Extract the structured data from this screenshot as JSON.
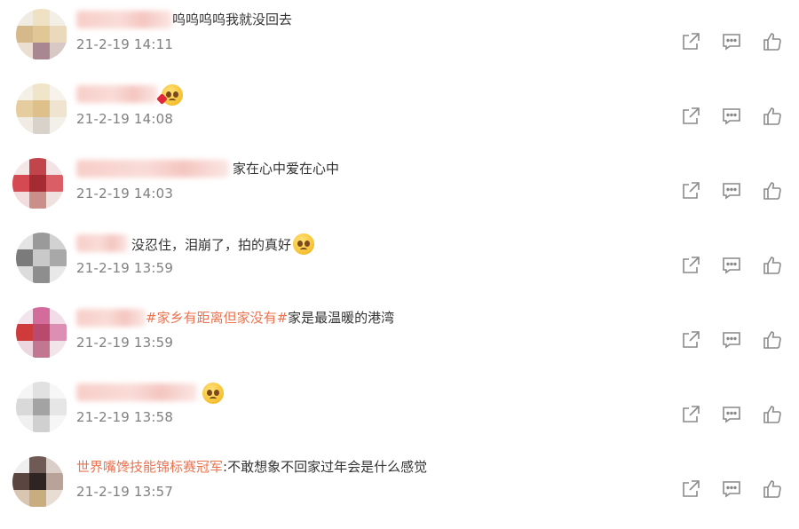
{
  "comments": [
    {
      "text": "呜呜呜呜我就没回去",
      "text_hl": "",
      "emoji": "",
      "time": "21-2-19 14:11"
    },
    {
      "text": "",
      "text_hl": "",
      "emoji": "kiss-face-emoji",
      "time": "21-2-19 14:08"
    },
    {
      "text": "家在心中爱在心中",
      "text_hl": "",
      "emoji": "",
      "time": "21-2-19 14:03"
    },
    {
      "text": "没忍住，泪崩了，拍的真好",
      "text_hl": "",
      "emoji": "tearful-face-emoji",
      "time": "21-2-19 13:59"
    },
    {
      "text": "家是最温暖的港湾",
      "text_hl": "#家乡有距离但家没有#",
      "emoji": "",
      "time": "21-2-19 13:59"
    },
    {
      "text": "",
      "text_hl": "",
      "emoji": "tearful-face-emoji",
      "time": "21-2-19 13:58"
    },
    {
      "text": ":不敢想象不回家过年会是什么感觉",
      "text_hl": "世界嘴馋技能锦标赛冠军",
      "emoji": "",
      "time": "21-2-19 13:57"
    }
  ],
  "icons": {
    "share": "share-icon",
    "reply": "comment-icon",
    "like": "thumbs-up-icon"
  },
  "colors": {
    "link": "#eb7350",
    "time": "#808080",
    "icon": "#8a8a8a"
  }
}
